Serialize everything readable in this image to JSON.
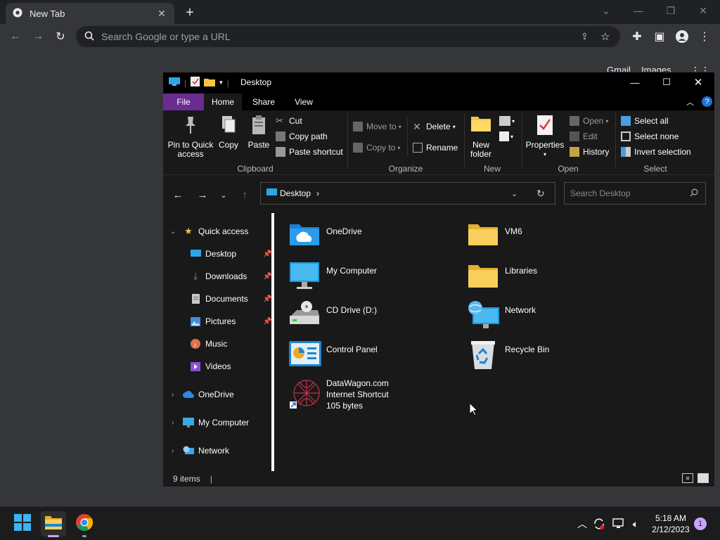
{
  "chrome": {
    "tab_title": "New Tab",
    "omnibox_placeholder": "Search Google or type a URL",
    "top_links": [
      "Gmail",
      "Images"
    ]
  },
  "explorer": {
    "title": "Desktop",
    "ribbon_tabs": [
      "File",
      "Home",
      "Share",
      "View"
    ],
    "clipboard": {
      "pin": "Pin to Quick access",
      "copy": "Copy",
      "paste": "Paste",
      "cut": "Cut",
      "copy_path": "Copy path",
      "paste_shortcut": "Paste shortcut",
      "label": "Clipboard"
    },
    "organize": {
      "move_to": "Move to",
      "copy_to": "Copy to",
      "delete": "Delete",
      "rename": "Rename",
      "label": "Organize"
    },
    "new_group": {
      "new_folder": "New folder",
      "label": "New"
    },
    "open_group": {
      "properties": "Properties",
      "open": "Open",
      "edit": "Edit",
      "history": "History",
      "label": "Open"
    },
    "select_group": {
      "select_all": "Select all",
      "select_none": "Select none",
      "invert": "Invert selection",
      "label": "Select"
    },
    "address": {
      "crumb": "Desktop"
    },
    "search_placeholder": "Search Desktop",
    "nav": {
      "quick_access": "Quick access",
      "quick_items": [
        "Desktop",
        "Downloads",
        "Documents",
        "Pictures",
        "Music",
        "Videos"
      ],
      "roots": [
        "OneDrive",
        "My Computer",
        "Network"
      ]
    },
    "items": [
      {
        "name": "OneDrive",
        "icon": "onedrive-folder-icon"
      },
      {
        "name": "VM6",
        "icon": "folder-icon"
      },
      {
        "name": "My Computer",
        "icon": "monitor-icon"
      },
      {
        "name": "Libraries",
        "icon": "folder-icon"
      },
      {
        "name": "CD Drive (D:)",
        "icon": "cd-drive-icon"
      },
      {
        "name": "Network",
        "icon": "network-icon"
      },
      {
        "name": "Control Panel",
        "icon": "control-panel-icon"
      },
      {
        "name": "Recycle Bin",
        "icon": "recycle-bin-icon"
      },
      {
        "name": "DataWagon.com",
        "line2": "Internet Shortcut",
        "line3": "105 bytes",
        "icon": "internet-shortcut-icon"
      }
    ],
    "status": "9 items"
  },
  "taskbar": {
    "time": "5:18 AM",
    "date": "2/12/2023",
    "notifications": "1"
  },
  "colors": {
    "file_tab": "#6a2c91",
    "folder_yellow": "#f5c443",
    "accent_blue": "#0078d4"
  }
}
